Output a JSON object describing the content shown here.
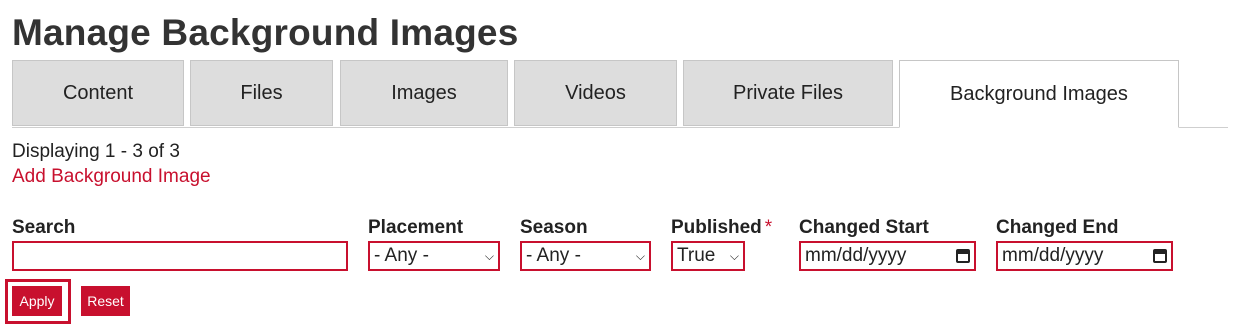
{
  "page": {
    "title": "Manage Background Images"
  },
  "tabs": [
    {
      "label": "Content"
    },
    {
      "label": "Files"
    },
    {
      "label": "Images"
    },
    {
      "label": "Videos"
    },
    {
      "label": "Private Files"
    },
    {
      "label": "Background Images",
      "active": true
    }
  ],
  "summary": {
    "count_text": "Displaying 1 - 3 of 3",
    "add_link": "Add Background Image"
  },
  "filters": {
    "search": {
      "label": "Search",
      "value": ""
    },
    "placement": {
      "label": "Placement",
      "value": "- Any -"
    },
    "season": {
      "label": "Season",
      "value": "- Any -"
    },
    "published": {
      "label": "Published",
      "required_mark": "*",
      "value": "True"
    },
    "changed_start": {
      "label": "Changed Start",
      "value": "mm/dd/yyyy"
    },
    "changed_end": {
      "label": "Changed End",
      "value": "mm/dd/yyyy"
    }
  },
  "actions": {
    "apply": "Apply",
    "reset": "Reset"
  },
  "colors": {
    "accent": "#c8102e",
    "tab_bg": "#dddddd",
    "text": "#222222"
  }
}
